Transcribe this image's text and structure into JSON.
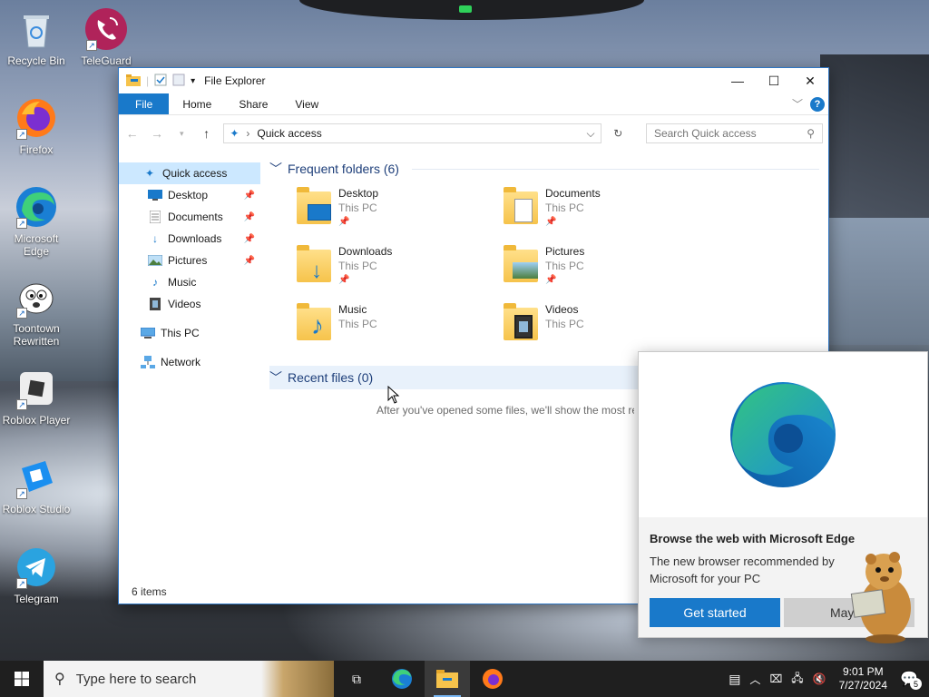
{
  "desktop": {
    "icons": [
      {
        "label": "Recycle Bin",
        "icon": "recycle-bin-icon"
      },
      {
        "label": "TeleGuard",
        "icon": "teleguard-icon"
      },
      {
        "label": "Firefox",
        "icon": "firefox-icon"
      },
      {
        "label": "Microsoft Edge",
        "icon": "edge-icon"
      },
      {
        "label": "Toontown Rewritten",
        "icon": "toontown-icon"
      },
      {
        "label": "Roblox Player",
        "icon": "roblox-icon"
      },
      {
        "label": "Roblox Studio",
        "icon": "roblox-studio-icon"
      },
      {
        "label": "Telegram",
        "icon": "telegram-icon"
      }
    ]
  },
  "explorer": {
    "title": "File Explorer",
    "ribbon_tabs": [
      "File",
      "Home",
      "Share",
      "View"
    ],
    "address": "Quick access",
    "search_placeholder": "Search Quick access",
    "nav": [
      {
        "label": "Quick access",
        "icon": "star-icon",
        "pinned": false,
        "selected": true
      },
      {
        "label": "Desktop",
        "icon": "desktop-icon",
        "pinned": true
      },
      {
        "label": "Documents",
        "icon": "documents-icon",
        "pinned": true
      },
      {
        "label": "Downloads",
        "icon": "downloads-icon",
        "pinned": true
      },
      {
        "label": "Pictures",
        "icon": "pictures-icon",
        "pinned": true
      },
      {
        "label": "Music",
        "icon": "music-icon",
        "pinned": false
      },
      {
        "label": "Videos",
        "icon": "videos-icon",
        "pinned": false
      },
      {
        "label": "This PC",
        "icon": "computer-icon",
        "pinned": false
      },
      {
        "label": "Network",
        "icon": "network-icon",
        "pinned": false
      }
    ],
    "frequent_header": "Frequent folders (6)",
    "folders": [
      {
        "name": "Desktop",
        "sub": "This PC",
        "pinned": true,
        "icon": "desktop-folder-icon"
      },
      {
        "name": "Documents",
        "sub": "This PC",
        "pinned": true,
        "icon": "documents-folder-icon"
      },
      {
        "name": "Downloads",
        "sub": "This PC",
        "pinned": true,
        "icon": "downloads-folder-icon"
      },
      {
        "name": "Pictures",
        "sub": "This PC",
        "pinned": true,
        "icon": "pictures-folder-icon"
      },
      {
        "name": "Music",
        "sub": "This PC",
        "pinned": false,
        "icon": "music-folder-icon"
      },
      {
        "name": "Videos",
        "sub": "This PC",
        "pinned": false,
        "icon": "videos-folder-icon"
      }
    ],
    "recent_header": "Recent files (0)",
    "recent_empty": "After you've opened some files, we'll show the most re",
    "status": "6 items"
  },
  "edge_popup": {
    "title": "Browse the web with Microsoft Edge",
    "description": "The new browser recommended by Microsoft for your PC",
    "primary": "Get started",
    "secondary": "Maybe"
  },
  "taskbar": {
    "search_placeholder": "Type here to search",
    "time": "9:01 PM",
    "date": "7/27/2024",
    "notification_count": "5"
  },
  "colors": {
    "accent": "#1979ca",
    "selection": "#cce8ff",
    "taskbar": "#1f1f1f"
  }
}
